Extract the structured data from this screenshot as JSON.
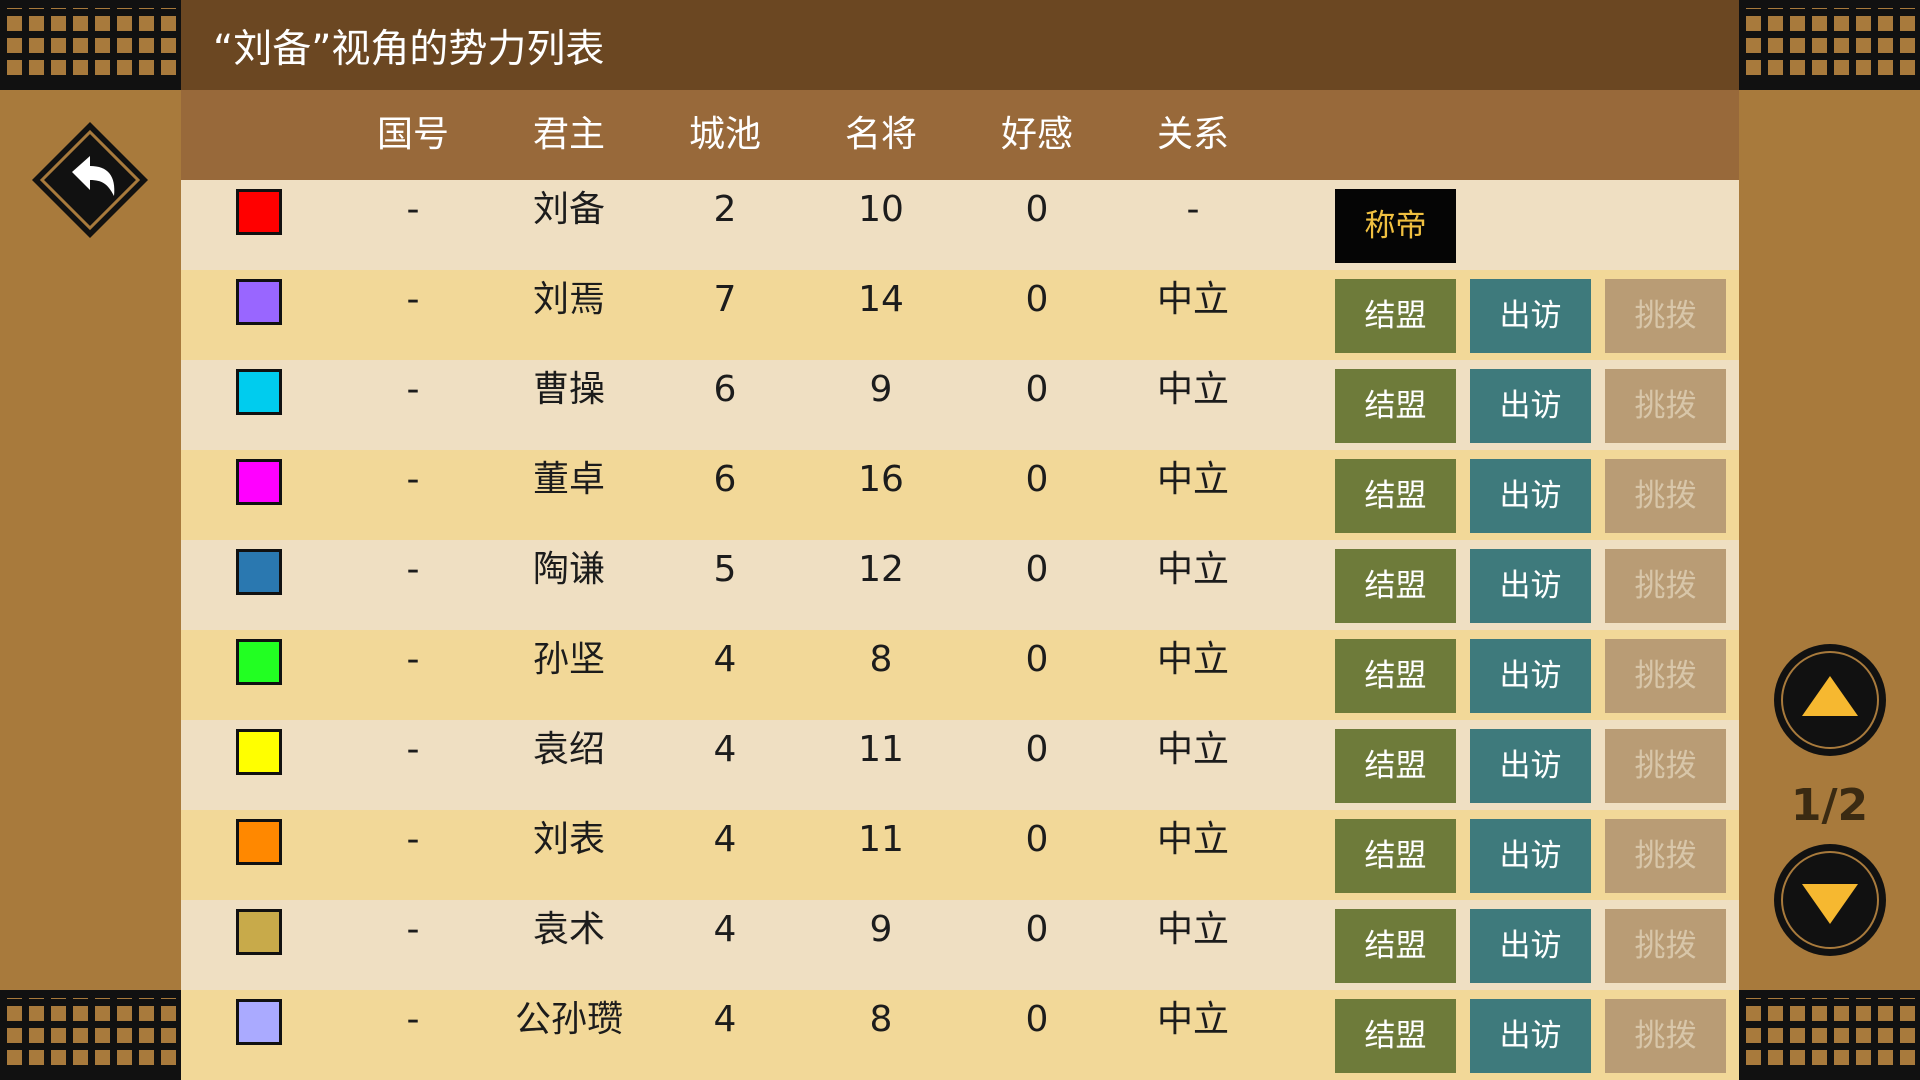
{
  "title": "“刘备”视角的势力列表",
  "columns": [
    "国号",
    "君主",
    "城池",
    "名将",
    "好感",
    "关系"
  ],
  "buttons": {
    "ally": "结盟",
    "visit": "出访",
    "sow": "挑拨",
    "emperor": "称帝"
  },
  "page_indicator": "1/2",
  "rows": [
    {
      "color": "#ff0000",
      "name": "-",
      "lord": "刘备",
      "cities": "2",
      "generals": "10",
      "favor": "0",
      "relation": "-",
      "self": true
    },
    {
      "color": "#9966ff",
      "name": "-",
      "lord": "刘焉",
      "cities": "7",
      "generals": "14",
      "favor": "0",
      "relation": "中立"
    },
    {
      "color": "#00ccee",
      "name": "-",
      "lord": "曹操",
      "cities": "6",
      "generals": "9",
      "favor": "0",
      "relation": "中立"
    },
    {
      "color": "#ff00ff",
      "name": "-",
      "lord": "董卓",
      "cities": "6",
      "generals": "16",
      "favor": "0",
      "relation": "中立"
    },
    {
      "color": "#2a78b0",
      "name": "-",
      "lord": "陶谦",
      "cities": "5",
      "generals": "12",
      "favor": "0",
      "relation": "中立"
    },
    {
      "color": "#22ff22",
      "name": "-",
      "lord": "孙坚",
      "cities": "4",
      "generals": "8",
      "favor": "0",
      "relation": "中立"
    },
    {
      "color": "#ffff00",
      "name": "-",
      "lord": "袁绍",
      "cities": "4",
      "generals": "11",
      "favor": "0",
      "relation": "中立"
    },
    {
      "color": "#ff8800",
      "name": "-",
      "lord": "刘表",
      "cities": "4",
      "generals": "11",
      "favor": "0",
      "relation": "中立"
    },
    {
      "color": "#c8aa4a",
      "name": "-",
      "lord": "袁术",
      "cities": "4",
      "generals": "9",
      "favor": "0",
      "relation": "中立"
    },
    {
      "color": "#aaaaff",
      "name": "-",
      "lord": "公孙瓒",
      "cities": "4",
      "generals": "8",
      "favor": "0",
      "relation": "中立"
    }
  ]
}
